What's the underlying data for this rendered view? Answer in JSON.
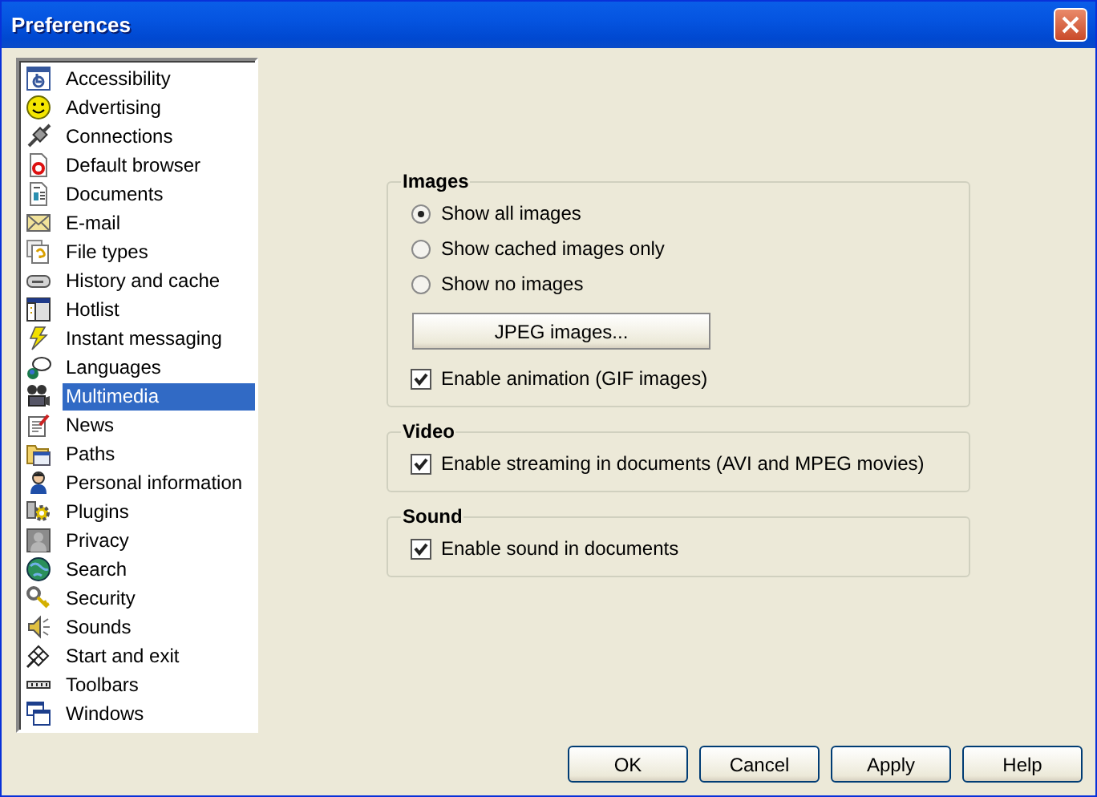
{
  "window": {
    "title": "Preferences"
  },
  "sidebar": {
    "items": [
      {
        "label": "Accessibility",
        "selected": false
      },
      {
        "label": "Advertising",
        "selected": false
      },
      {
        "label": "Connections",
        "selected": false
      },
      {
        "label": "Default browser",
        "selected": false
      },
      {
        "label": "Documents",
        "selected": false
      },
      {
        "label": "E-mail",
        "selected": false
      },
      {
        "label": "File types",
        "selected": false
      },
      {
        "label": "History and cache",
        "selected": false
      },
      {
        "label": "Hotlist",
        "selected": false
      },
      {
        "label": "Instant messaging",
        "selected": false
      },
      {
        "label": "Languages",
        "selected": false
      },
      {
        "label": "Multimedia",
        "selected": true
      },
      {
        "label": "News",
        "selected": false
      },
      {
        "label": "Paths",
        "selected": false
      },
      {
        "label": "Personal information",
        "selected": false
      },
      {
        "label": "Plugins",
        "selected": false
      },
      {
        "label": "Privacy",
        "selected": false
      },
      {
        "label": "Search",
        "selected": false
      },
      {
        "label": "Security",
        "selected": false
      },
      {
        "label": "Sounds",
        "selected": false
      },
      {
        "label": "Start and exit",
        "selected": false
      },
      {
        "label": "Toolbars",
        "selected": false
      },
      {
        "label": "Windows",
        "selected": false
      }
    ]
  },
  "groups": [
    {
      "title": "Images",
      "items": [
        {
          "kind": "radio",
          "label": "Show all images",
          "selected": true
        },
        {
          "kind": "radio",
          "label": "Show cached images only",
          "selected": false
        },
        {
          "kind": "radio",
          "label": "Show no images",
          "selected": false
        },
        {
          "kind": "button",
          "label": "JPEG images..."
        },
        {
          "kind": "checkbox",
          "label": "Enable animation (GIF images)",
          "checked": true
        }
      ]
    },
    {
      "title": "Video",
      "items": [
        {
          "kind": "checkbox",
          "label": "Enable streaming in documents (AVI and MPEG movies)",
          "checked": true
        }
      ]
    },
    {
      "title": "Sound",
      "items": [
        {
          "kind": "checkbox",
          "label": "Enable sound in documents",
          "checked": true
        }
      ]
    }
  ],
  "buttons": [
    "OK",
    "Cancel",
    "Apply",
    "Help"
  ]
}
